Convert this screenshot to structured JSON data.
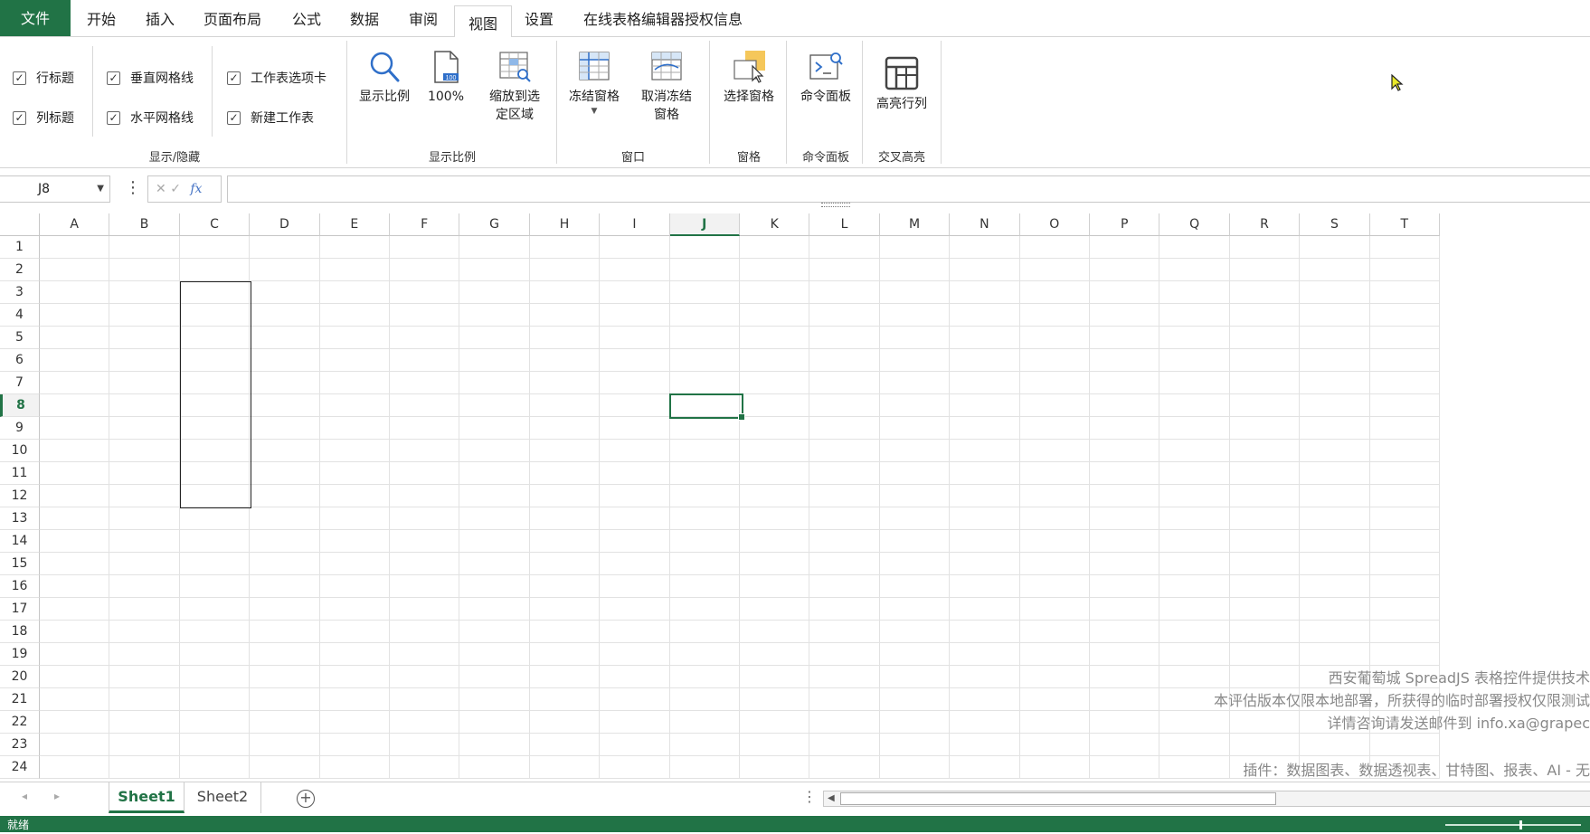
{
  "tabs": {
    "file": "文件",
    "home": "开始",
    "insert": "插入",
    "page_layout": "页面布局",
    "formulas": "公式",
    "data": "数据",
    "review": "审阅",
    "view": "视图",
    "settings": "设置",
    "license": "在线表格编辑器授权信息",
    "active": "视图"
  },
  "ribbon": {
    "show_hide": {
      "row_header": "行标题",
      "column_header": "列标题",
      "vertical_gridlines": "垂直网格线",
      "horizontal_gridlines": "水平网格线",
      "sheet_tabs": "工作表选项卡",
      "new_sheet": "新建工作表",
      "label": "显示/隐藏"
    },
    "zoom_group": {
      "zoom": "显示比例",
      "hundred": "100%",
      "zoom_to_selection_1": "缩放到选",
      "zoom_to_selection_2": "定区域",
      "label": "显示比例"
    },
    "window_group": {
      "freeze": "冻结窗格",
      "unfreeze_1": "取消冻结",
      "unfreeze_2": "窗格",
      "label": "窗口"
    },
    "pane_group": {
      "select_pane": "选择窗格",
      "label": "窗格"
    },
    "command_group": {
      "command_panel": "命令面板",
      "label": "命令面板"
    },
    "highlight_group": {
      "highlight": "高亮行列",
      "label": "交叉高亮"
    }
  },
  "formula_bar": {
    "name_box": "J8",
    "fx": "fx",
    "cancel": "✕",
    "confirm": "✓",
    "formula": ""
  },
  "grid": {
    "columns": [
      "A",
      "B",
      "C",
      "D",
      "E",
      "F",
      "G",
      "H",
      "I",
      "J",
      "K",
      "L",
      "M",
      "N",
      "O",
      "P",
      "Q",
      "R",
      "S",
      "T"
    ],
    "rows": [
      "1",
      "2",
      "3",
      "4",
      "5",
      "6",
      "7",
      "8",
      "9",
      "10",
      "11",
      "12",
      "13",
      "14",
      "15",
      "16",
      "17",
      "18",
      "19",
      "20",
      "21",
      "22",
      "23",
      "24"
    ],
    "active_cell": "J8",
    "active_column": "J",
    "active_row": "8"
  },
  "watermark": {
    "line1": "西安葡萄城 SpreadJS 表格控件提供技术",
    "line2": "本评估版本仅限本地部署，所获得的临时部署授权仅限测试",
    "line3": "详情咨询请发送邮件到 info.xa@grapec",
    "line4": "插件：数据图表、数据透视表、甘特图、报表、AI - 无"
  },
  "sheets": {
    "sheet1": "Sheet1",
    "sheet2": "Sheet2",
    "active": "Sheet1"
  },
  "status": {
    "text": "就绪"
  },
  "colors": {
    "accent": "#217346"
  }
}
